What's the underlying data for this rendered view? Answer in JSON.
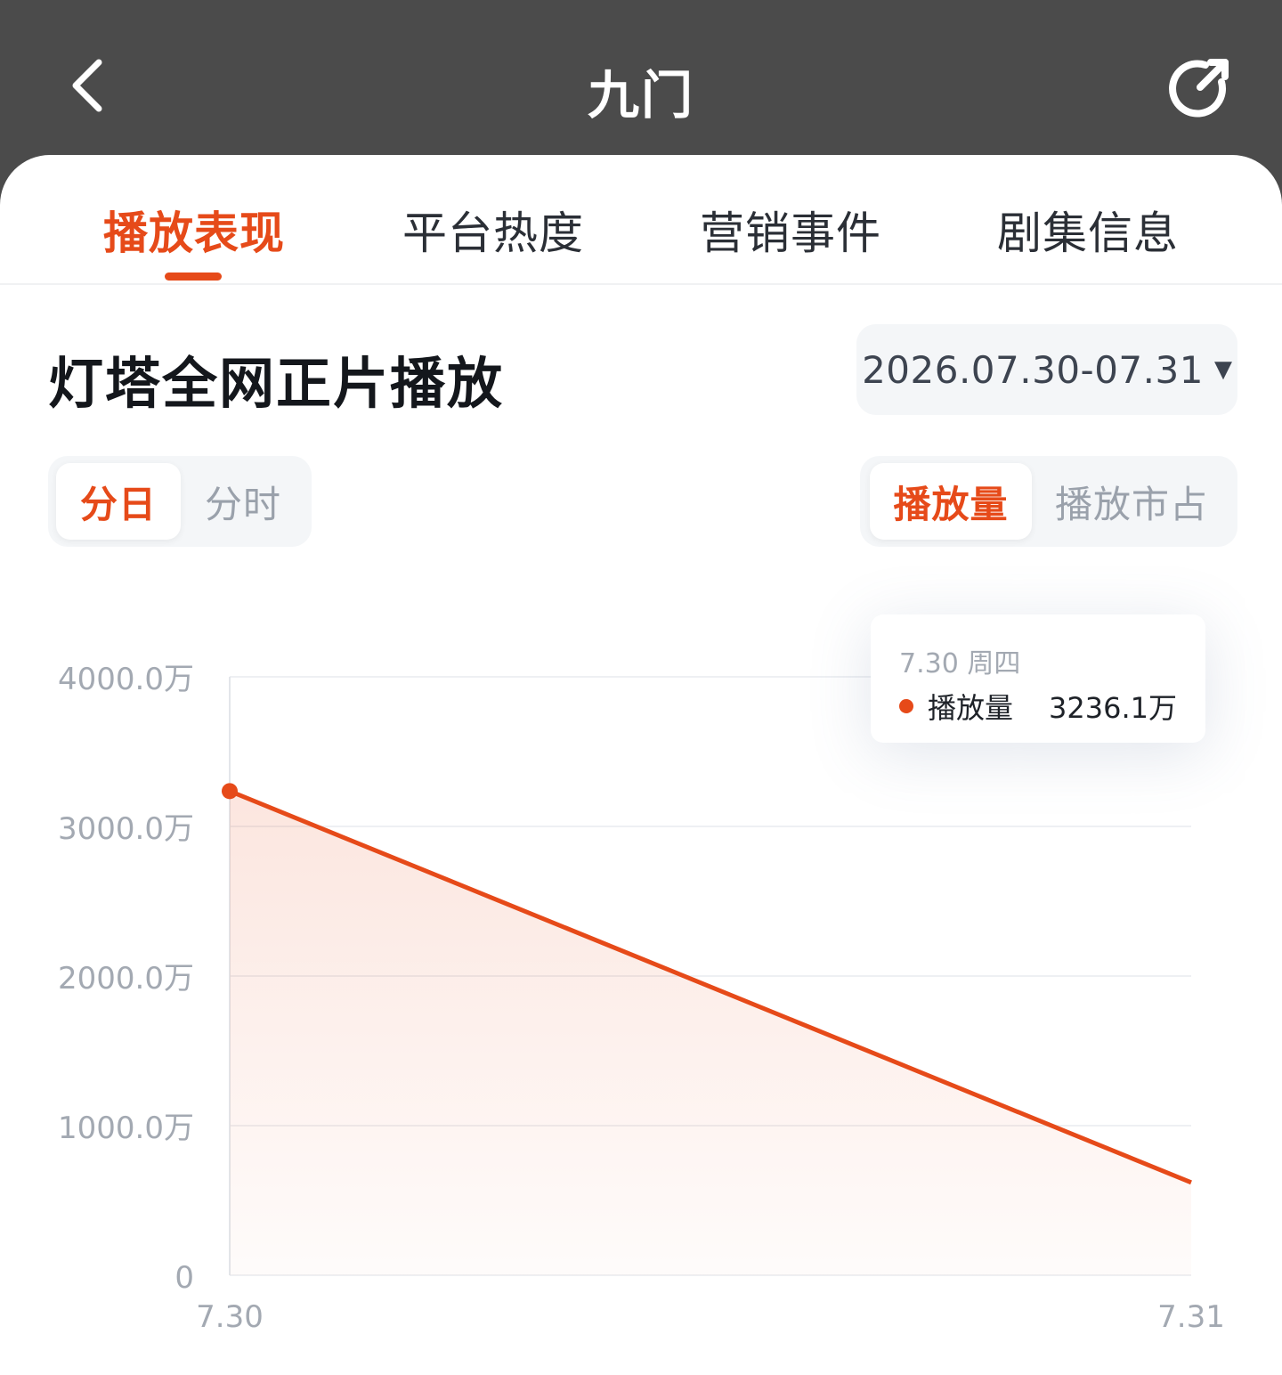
{
  "header": {
    "title": "九门",
    "back_icon": "chevron-left-icon",
    "refresh_icon": "refresh-icon"
  },
  "tabs": [
    {
      "label": "播放表现",
      "active": true
    },
    {
      "label": "平台热度",
      "active": false
    },
    {
      "label": "营销事件",
      "active": false
    },
    {
      "label": "剧集信息",
      "active": false
    }
  ],
  "section": {
    "title": "灯塔全网正片播放",
    "date_range": "2026.07.30-07.31",
    "date_caret": "▼"
  },
  "granularity": {
    "options": [
      "分日",
      "分时"
    ],
    "selected": "分日"
  },
  "metric": {
    "options": [
      "播放量",
      "播放市占"
    ],
    "selected": "播放量"
  },
  "tooltip": {
    "date": "7.30 周四",
    "series_label": "播放量",
    "value": "3236.1万"
  },
  "colors": {
    "accent": "#e64a19",
    "header_bg": "#4b4b4b",
    "axis_text": "#a3a9b2",
    "grid": "#eef0f3"
  },
  "chart_data": {
    "type": "area",
    "x": [
      "7.30",
      "7.31"
    ],
    "series": [
      {
        "values": [
          3236.1,
          620
        ]
      }
    ],
    "ylim": [
      0,
      4000
    ],
    "y_ticks": [
      {
        "value": 0,
        "label": "0"
      },
      {
        "value": 1000,
        "label": "1000.0万"
      },
      {
        "value": 2000,
        "label": "2000.0万"
      },
      {
        "value": 3000,
        "label": "3000.0万"
      },
      {
        "value": 4000,
        "label": "4000.0万"
      }
    ],
    "unit": "万",
    "grid": true,
    "highlight_index": 0
  }
}
